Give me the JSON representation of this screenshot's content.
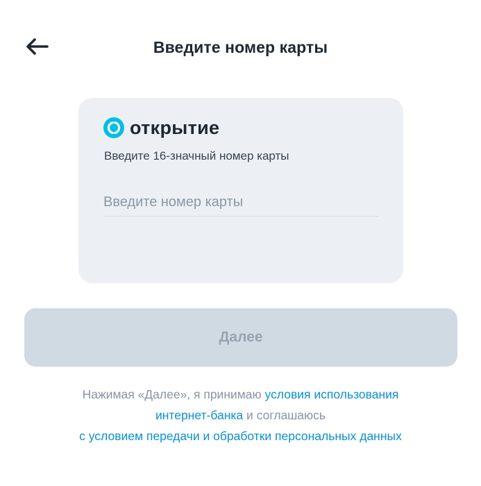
{
  "header": {
    "title": "Введите номер карты"
  },
  "card": {
    "brand_name": "открытие",
    "hint": "Введите 16-значный номер карты",
    "input_placeholder": "Введите номер карты",
    "input_value": ""
  },
  "actions": {
    "next_label": "Далее"
  },
  "legal": {
    "text_1": "Нажимая «Далее», я принимаю ",
    "link_1": "условия использования интернет-банка",
    "text_2": " и соглашаюсь ",
    "link_2": "с условием передачи и обработки персональных данных"
  },
  "colors": {
    "accent_link": "#0b8fd2",
    "brand_logo": "#00bee6",
    "card_background": "#ecf0f4",
    "button_disabled_bg": "#d0dae2",
    "button_disabled_text": "#97a5b2"
  }
}
